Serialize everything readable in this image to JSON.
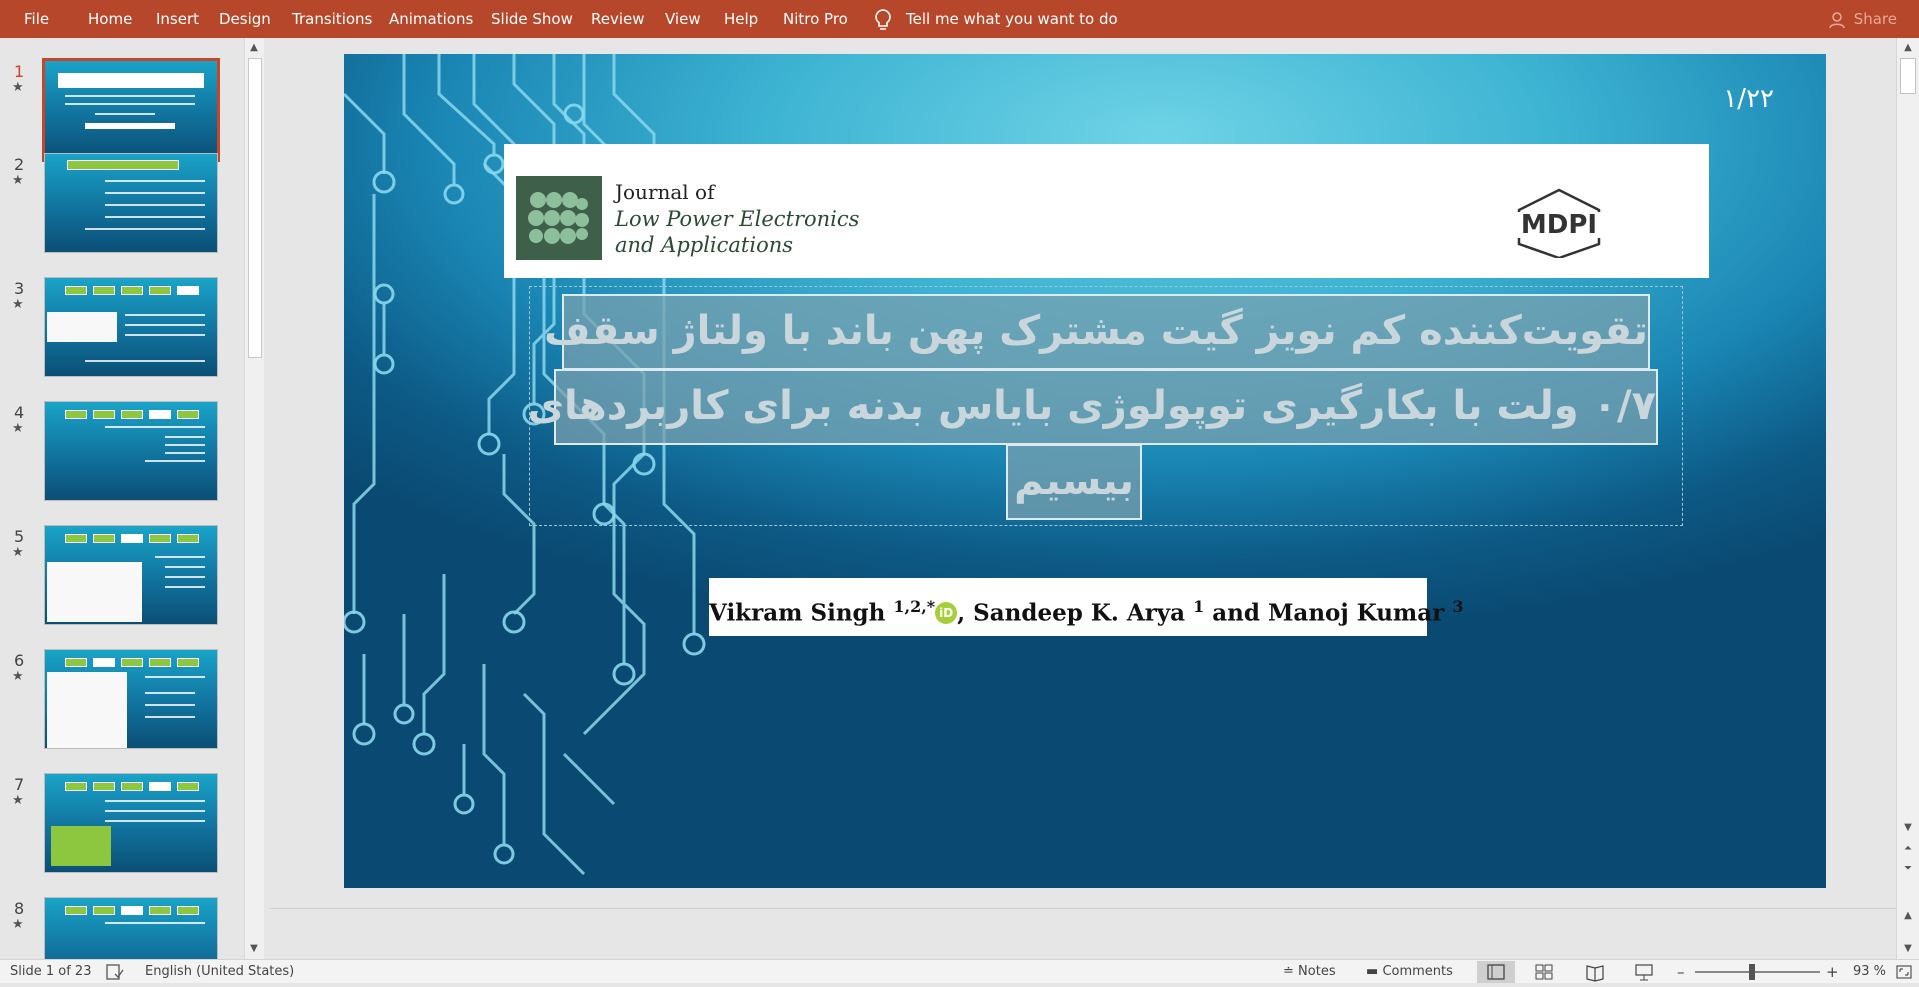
{
  "ribbon": {
    "tabs": [
      "File",
      "Home",
      "Insert",
      "Design",
      "Transitions",
      "Animations",
      "Slide Show",
      "Review",
      "View",
      "Help",
      "Nitro Pro"
    ],
    "tell_me": "Tell me what you want to do",
    "share": "Share",
    "color": "#b7472a"
  },
  "thumbnails": [
    {
      "num": "1",
      "star": "★"
    },
    {
      "num": "2",
      "star": "★"
    },
    {
      "num": "3",
      "star": "★"
    },
    {
      "num": "4",
      "star": "★"
    },
    {
      "num": "5",
      "star": "★"
    },
    {
      "num": "6",
      "star": "★"
    },
    {
      "num": "7",
      "star": "★"
    },
    {
      "num": "8",
      "star": "★"
    }
  ],
  "selected_slide": 1,
  "slide": {
    "page_number": "۱/۲۲",
    "journal_of": "Journal of",
    "journal_line1": "Low Power Electronics",
    "journal_line2": "and Applications",
    "publisher": "MDPI",
    "title_lines": [
      "تقویت‌کننده کم نویز گیت مشترک پهن باند با ولتاژ سقف",
      "۰/۷ ولت با بکارگیری توپولوژی بایاس بدنه برای کاربردهای",
      "بیسیم"
    ],
    "authors": {
      "a1": "Vikram Singh",
      "a1_sup": "1,2,*",
      "orcid": "iD",
      "a2": ", Sandeep K. Arya",
      "a2_sup": "1",
      "a3": " and Manoj Kumar",
      "a3_sup": "3"
    }
  },
  "status": {
    "slide_of": "Slide 1 of 23",
    "language": "English (United States)",
    "notes": "Notes",
    "comments": "Comments",
    "zoom_minus": "–",
    "zoom_plus": "+",
    "zoom": "93 %",
    "zoom_value": 93
  }
}
